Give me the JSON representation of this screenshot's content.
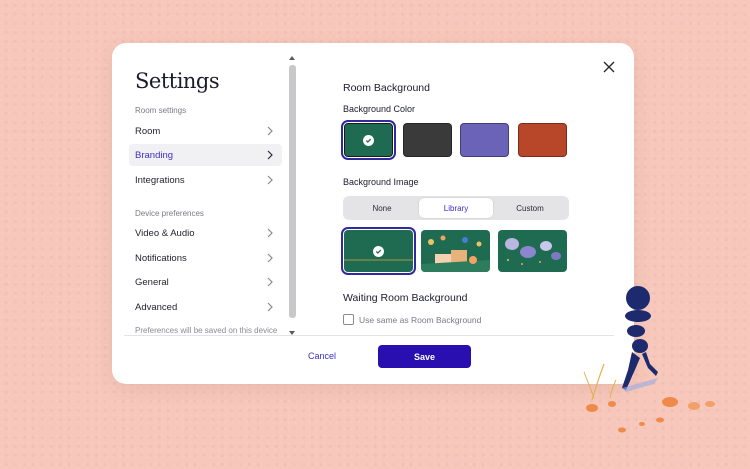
{
  "settings": {
    "title": "Settings",
    "sections": {
      "room_settings_label": "Room settings",
      "device_preferences_label": "Device preferences"
    },
    "nav": [
      {
        "label": "Room",
        "active": false
      },
      {
        "label": "Branding",
        "active": true
      },
      {
        "label": "Integrations",
        "active": false
      },
      {
        "label": "Video & Audio",
        "active": false
      },
      {
        "label": "Notifications",
        "active": false
      },
      {
        "label": "General",
        "active": false
      },
      {
        "label": "Advanced",
        "active": false
      }
    ],
    "footnote": "Preferences will be saved on this device"
  },
  "branding": {
    "room_background_heading": "Room Background",
    "background_color_label": "Background Color",
    "colors": [
      {
        "hex": "#1f6b52",
        "selected": true
      },
      {
        "hex": "#3a3a3a",
        "selected": false
      },
      {
        "hex": "#6a63b8",
        "selected": false
      },
      {
        "hex": "#b8472a",
        "selected": false
      }
    ],
    "background_image_label": "Background Image",
    "image_tabs": [
      {
        "label": "None",
        "active": false
      },
      {
        "label": "Library",
        "active": true
      },
      {
        "label": "Custom",
        "active": false
      }
    ],
    "images": [
      {
        "name": "plain-green",
        "selected": true
      },
      {
        "name": "balloons-scene",
        "selected": false
      },
      {
        "name": "rocks-scene",
        "selected": false
      }
    ],
    "waiting_room_heading": "Waiting Room Background",
    "same_as_room_label": "Use same as Room Background",
    "same_as_room_checked": false
  },
  "actions": {
    "cancel": "Cancel",
    "save": "Save"
  },
  "colors": {
    "accent": "#2a0fb0",
    "page_background": "#f6c7ba"
  }
}
